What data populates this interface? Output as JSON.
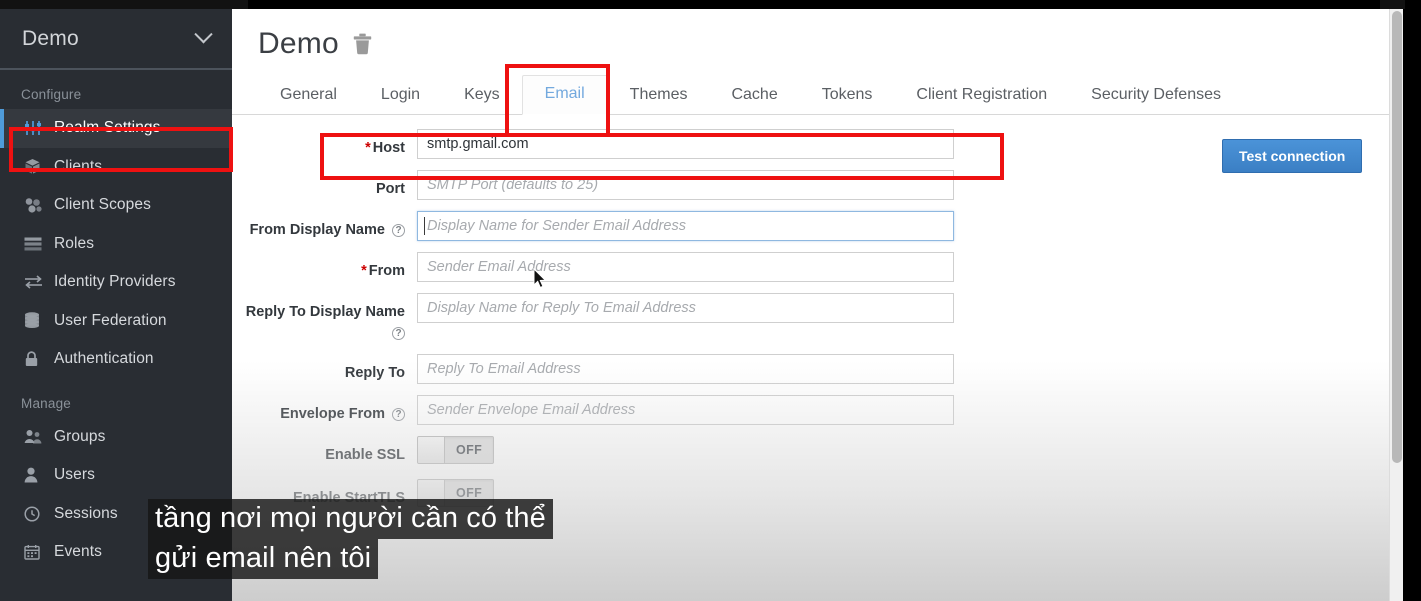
{
  "sidebar": {
    "realm_selector": {
      "name": "Demo",
      "chevron_icon": "chevron-down-icon"
    },
    "sections": [
      {
        "title": "Configure",
        "items": [
          {
            "label": "Realm Settings",
            "icon": "sliders-icon",
            "active": true
          },
          {
            "label": "Clients",
            "icon": "cube-icon",
            "active": false
          },
          {
            "label": "Client Scopes",
            "icon": "blocks-icon",
            "active": false
          },
          {
            "label": "Roles",
            "icon": "list-icon",
            "active": false
          },
          {
            "label": "Identity Providers",
            "icon": "exchange-icon",
            "active": false
          },
          {
            "label": "User Federation",
            "icon": "database-icon",
            "active": false
          },
          {
            "label": "Authentication",
            "icon": "lock-icon",
            "active": false
          }
        ]
      },
      {
        "title": "Manage",
        "items": [
          {
            "label": "Groups",
            "icon": "users-group-icon",
            "active": false
          },
          {
            "label": "Users",
            "icon": "user-icon",
            "active": false
          },
          {
            "label": "Sessions",
            "icon": "clock-icon",
            "active": false
          },
          {
            "label": "Events",
            "icon": "calendar-icon",
            "active": false
          }
        ]
      }
    ]
  },
  "main": {
    "page_title": "Demo",
    "delete_icon": "trash-icon",
    "tabs": [
      {
        "label": "General",
        "active": false
      },
      {
        "label": "Login",
        "active": false
      },
      {
        "label": "Keys",
        "active": false
      },
      {
        "label": "Email",
        "active": true
      },
      {
        "label": "Themes",
        "active": false
      },
      {
        "label": "Cache",
        "active": false
      },
      {
        "label": "Tokens",
        "active": false
      },
      {
        "label": "Client Registration",
        "active": false
      },
      {
        "label": "Security Defenses",
        "active": false
      }
    ],
    "test_connection_label": "Test connection",
    "fields": [
      {
        "label": "Host",
        "required": true,
        "help": false,
        "type": "text",
        "value": "smtp.gmail.com",
        "placeholder": "",
        "focused": false
      },
      {
        "label": "Port",
        "required": false,
        "help": false,
        "type": "text",
        "value": "",
        "placeholder": "SMTP Port (defaults to 25)",
        "focused": false
      },
      {
        "label": "From Display Name",
        "required": false,
        "help": true,
        "type": "text",
        "value": "",
        "placeholder": "Display Name for Sender Email Address",
        "focused": true
      },
      {
        "label": "From",
        "required": true,
        "help": false,
        "type": "text",
        "value": "",
        "placeholder": "Sender Email Address",
        "focused": false
      },
      {
        "label": "Reply To Display Name",
        "required": false,
        "help": true,
        "type": "text",
        "value": "",
        "placeholder": "Display Name for Reply To Email Address",
        "focused": false
      },
      {
        "label": "Reply To",
        "required": false,
        "help": false,
        "type": "text",
        "value": "",
        "placeholder": "Reply To Email Address",
        "focused": false
      },
      {
        "label": "Envelope From",
        "required": false,
        "help": true,
        "type": "text",
        "value": "",
        "placeholder": "Sender Envelope Email Address",
        "focused": false
      },
      {
        "label": "Enable SSL",
        "required": false,
        "help": false,
        "type": "toggle",
        "value": "OFF",
        "placeholder": "",
        "focused": false
      },
      {
        "label": "Enable StartTLS",
        "required": false,
        "help": false,
        "type": "toggle",
        "value": "OFF",
        "placeholder": "",
        "focused": false
      }
    ]
  },
  "subtitles": {
    "line1": "tầng nơi mọi người cần có thể",
    "line2": "gửi email nên tôi"
  },
  "colors": {
    "accent_blue": "#4f9bd9",
    "sidebar_bg": "#292d33",
    "sidebar_active_bg": "#35393f",
    "annotation_red": "#ee1111",
    "required_red": "#cc0000",
    "button_blue": "#3b7fc4",
    "active_tab_text": "#73a9de"
  }
}
